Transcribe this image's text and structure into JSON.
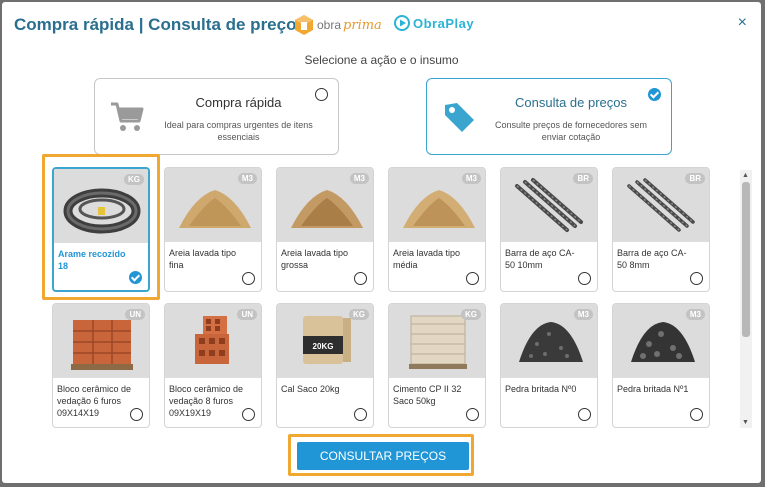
{
  "header": {
    "title": "Compra rápida | Consulta de preços",
    "logo_obra_left": "obra",
    "logo_obra_right": "prima",
    "logo_play": "ObraPlay",
    "close": "×"
  },
  "subtitle": "Selecione a ação e o insumo",
  "actions": [
    {
      "title": "Compra rápida",
      "desc": "Ideal para compras urgentes de itens essenciais",
      "selected": false
    },
    {
      "title": "Consulta de preços",
      "desc": "Consulte preços de fornecedores sem enviar cotação",
      "selected": true
    }
  ],
  "items": [
    {
      "name": "Arame recozido 18",
      "unit": "KG",
      "selected": true
    },
    {
      "name": "Areia lavada tipo fina",
      "unit": "M3",
      "selected": false
    },
    {
      "name": "Areia lavada tipo grossa",
      "unit": "M3",
      "selected": false
    },
    {
      "name": "Areia lavada tipo média",
      "unit": "M3",
      "selected": false
    },
    {
      "name": "Barra de aço CA-50 10mm",
      "unit": "BR",
      "selected": false
    },
    {
      "name": "Barra de aço CA-50 8mm",
      "unit": "BR",
      "selected": false
    },
    {
      "name": "Bloco cerâmico de vedação 6 furos 09X14X19",
      "unit": "UN",
      "selected": false
    },
    {
      "name": "Bloco cerâmico de vedação 8 furos 09X19X19",
      "unit": "UN",
      "selected": false
    },
    {
      "name": "Cal Saco 20kg",
      "unit": "KG",
      "selected": false
    },
    {
      "name": "Cimento CP II 32 Saco 50kg",
      "unit": "KG",
      "selected": false
    },
    {
      "name": "Pedra britada Nº0",
      "unit": "M3",
      "selected": false
    },
    {
      "name": "Pedra britada Nº1",
      "unit": "M3",
      "selected": false
    }
  ],
  "bag_labels": {
    "cal": "20KG"
  },
  "submit_label": "CONSULTAR PREÇOS",
  "colors": {
    "accent": "#2196d6",
    "title": "#2a6f8f",
    "highlight": "#f0a830",
    "logo_orange": "#e59a2e",
    "logo_cyan": "#2bb3d6"
  }
}
